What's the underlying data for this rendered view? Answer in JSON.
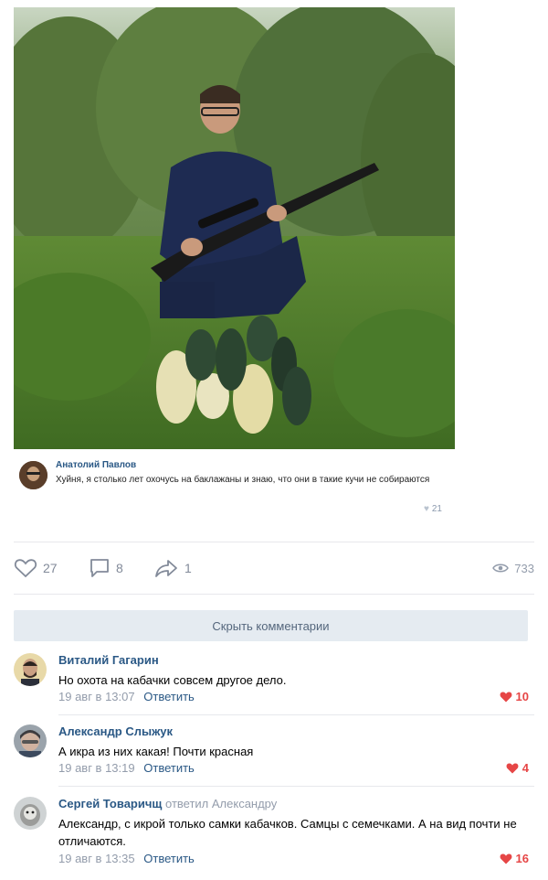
{
  "post": {
    "inner_comment": {
      "author": "Анатолий Павлов",
      "text": "Хуйня, я столько лет охочусь на баклажаны и знаю, что они в такие кучи не собираются",
      "likes": "21"
    },
    "actions": {
      "likes": "27",
      "comments": "8",
      "shares": "1",
      "views": "733"
    }
  },
  "hide_comments_label": "Скрыть комментарии",
  "comments": [
    {
      "author": "Виталий Гагарин",
      "text": "Но охота на кабачки совсем другое дело.",
      "date": "19 авг в 13:07",
      "reply_label": "Ответить",
      "likes": "10"
    },
    {
      "author": "Александр Слыжук",
      "text": "А икра из них какая! Почти красная",
      "date": "19 авг в 13:19",
      "reply_label": "Ответить",
      "likes": "4"
    },
    {
      "author": "Сергей Товаричщ",
      "replied_to": "ответил Александру",
      "text": "Александр, с икрой только самки кабачков. Самцы с семечками. А на вид почти не отличаются.",
      "date": "19 авг в 13:35",
      "reply_label": "Ответить",
      "likes": "16"
    }
  ],
  "icons": {
    "like": "heart-icon",
    "comment": "comment-icon",
    "share": "share-icon",
    "views": "eye-icon"
  },
  "colors": {
    "link": "#2a5885",
    "muted": "#939cab",
    "like_active": "#e64646",
    "button_bg": "#e5ebf1"
  }
}
